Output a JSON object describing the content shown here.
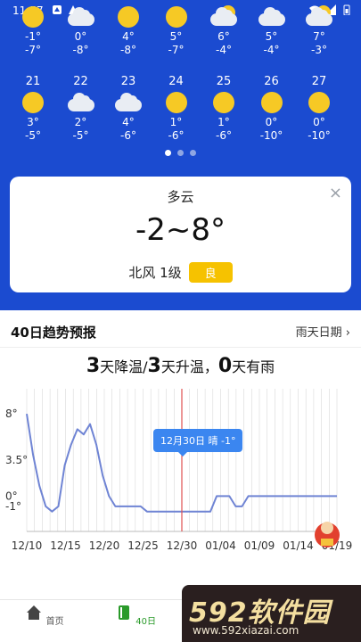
{
  "status_bar": {
    "time": "11:57"
  },
  "forecast_top": [
    {
      "icon": "sunny",
      "high": "-1°",
      "low": "-7°"
    },
    {
      "icon": "cloudy",
      "high": "0°",
      "low": "-8°"
    },
    {
      "icon": "sunny",
      "high": "4°",
      "low": "-8°"
    },
    {
      "icon": "sunny",
      "high": "5°",
      "low": "-7°"
    },
    {
      "icon": "partly-cloudy",
      "high": "6°",
      "low": "-4°"
    },
    {
      "icon": "cloudy",
      "high": "5°",
      "low": "-4°"
    },
    {
      "icon": "partly-cloudy",
      "high": "7°",
      "low": "-3°"
    }
  ],
  "forecast_bottom": [
    {
      "day": "21",
      "icon": "sunny",
      "high": "3°",
      "low": "-5°"
    },
    {
      "day": "22",
      "icon": "cloudy",
      "high": "2°",
      "low": "-5°"
    },
    {
      "day": "23",
      "icon": "cloudy",
      "high": "4°",
      "low": "-6°"
    },
    {
      "day": "24",
      "icon": "sunny",
      "high": "1°",
      "low": "-6°"
    },
    {
      "day": "25",
      "icon": "sunny",
      "high": "1°",
      "low": "-6°"
    },
    {
      "day": "26",
      "icon": "sunny",
      "high": "0°",
      "low": "-10°"
    },
    {
      "day": "27",
      "icon": "sunny",
      "high": "0°",
      "low": "-10°"
    }
  ],
  "detail": {
    "close_label": "×",
    "condition": "多云",
    "range": "-2~8°",
    "wind": "北风 1级",
    "aqi": "良"
  },
  "trend": {
    "title": "40日趋势预报",
    "rain_link": "雨天日期",
    "summary": {
      "n1": "3",
      "t1": "天降温/",
      "n2": "3",
      "t2": "天升温，",
      "n3": "0",
      "t3": "天有雨"
    },
    "tooltip": "12月30日 晴 -1°"
  },
  "chart_data": {
    "type": "line",
    "x": [
      "12/10",
      "12/15",
      "12/20",
      "12/25",
      "12/30",
      "01/04",
      "01/09",
      "01/14",
      "01/19"
    ],
    "y_ticks": [
      "8°",
      "3.5°",
      "0°",
      "-1°"
    ],
    "series": [
      {
        "values": [
          8,
          4,
          1,
          -1,
          -1.5,
          -1,
          3,
          5,
          6.5,
          6,
          7,
          5,
          2,
          0,
          -1,
          -1,
          -1,
          -1,
          -1,
          -1.5,
          -1.5,
          -1.5,
          -1.5,
          -1.5,
          -1.5,
          -1.5,
          -1.5,
          -1.5,
          -1.5,
          -1.5,
          0,
          0,
          0,
          -1,
          -1,
          0,
          0,
          0,
          0,
          0,
          0,
          0,
          0,
          0,
          0,
          0,
          0,
          0,
          0,
          0
        ]
      }
    ],
    "highlight_date": "12/30",
    "colors": {
      "line": "#6f84d4",
      "marker": "#e05050",
      "grid": "#d9d9d9"
    }
  },
  "nav": {
    "home": "首页",
    "forty": "40日"
  },
  "watermark": {
    "main": "592软件园",
    "url": "www.592xiazai.com"
  }
}
